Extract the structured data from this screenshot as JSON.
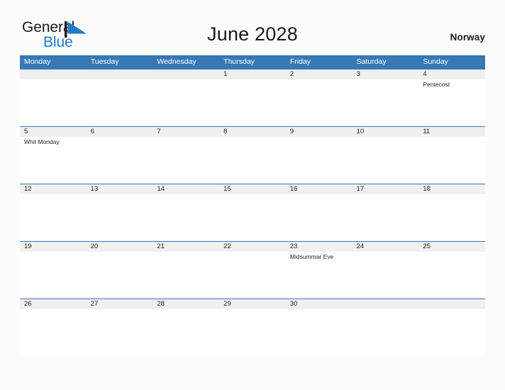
{
  "brand": {
    "name_part1": "General",
    "name_part2": "Blue",
    "flag_icon": "blue-triangle-flag-icon",
    "accent_color": "#1f7bc4"
  },
  "header": {
    "title": "June 2028",
    "country": "Norway"
  },
  "colors": {
    "header_blue": "#3878b4",
    "date_band_gray": "#f0f0f0",
    "page_background": "#fcfcfc",
    "brand_blue": "#1f7bc4",
    "text": "#222222"
  },
  "calendar": {
    "month": "June",
    "year": "2028",
    "weekday_headers": [
      "Monday",
      "Tuesday",
      "Wednesday",
      "Thursday",
      "Friday",
      "Saturday",
      "Sunday"
    ],
    "weeks": [
      {
        "days": [
          {
            "number": "",
            "event": ""
          },
          {
            "number": "",
            "event": ""
          },
          {
            "number": "",
            "event": ""
          },
          {
            "number": "1",
            "event": ""
          },
          {
            "number": "2",
            "event": ""
          },
          {
            "number": "3",
            "event": ""
          },
          {
            "number": "4",
            "event": "Pentecost"
          }
        ]
      },
      {
        "days": [
          {
            "number": "5",
            "event": "Whit Monday"
          },
          {
            "number": "6",
            "event": ""
          },
          {
            "number": "7",
            "event": ""
          },
          {
            "number": "8",
            "event": ""
          },
          {
            "number": "9",
            "event": ""
          },
          {
            "number": "10",
            "event": ""
          },
          {
            "number": "11",
            "event": ""
          }
        ]
      },
      {
        "days": [
          {
            "number": "12",
            "event": ""
          },
          {
            "number": "13",
            "event": ""
          },
          {
            "number": "14",
            "event": ""
          },
          {
            "number": "15",
            "event": ""
          },
          {
            "number": "16",
            "event": ""
          },
          {
            "number": "17",
            "event": ""
          },
          {
            "number": "18",
            "event": ""
          }
        ]
      },
      {
        "days": [
          {
            "number": "19",
            "event": ""
          },
          {
            "number": "20",
            "event": ""
          },
          {
            "number": "21",
            "event": ""
          },
          {
            "number": "22",
            "event": ""
          },
          {
            "number": "23",
            "event": "Midsummar Eve"
          },
          {
            "number": "24",
            "event": ""
          },
          {
            "number": "25",
            "event": ""
          }
        ]
      },
      {
        "days": [
          {
            "number": "26",
            "event": ""
          },
          {
            "number": "27",
            "event": ""
          },
          {
            "number": "28",
            "event": ""
          },
          {
            "number": "29",
            "event": ""
          },
          {
            "number": "30",
            "event": ""
          },
          {
            "number": "",
            "event": ""
          },
          {
            "number": "",
            "event": ""
          }
        ]
      }
    ]
  }
}
